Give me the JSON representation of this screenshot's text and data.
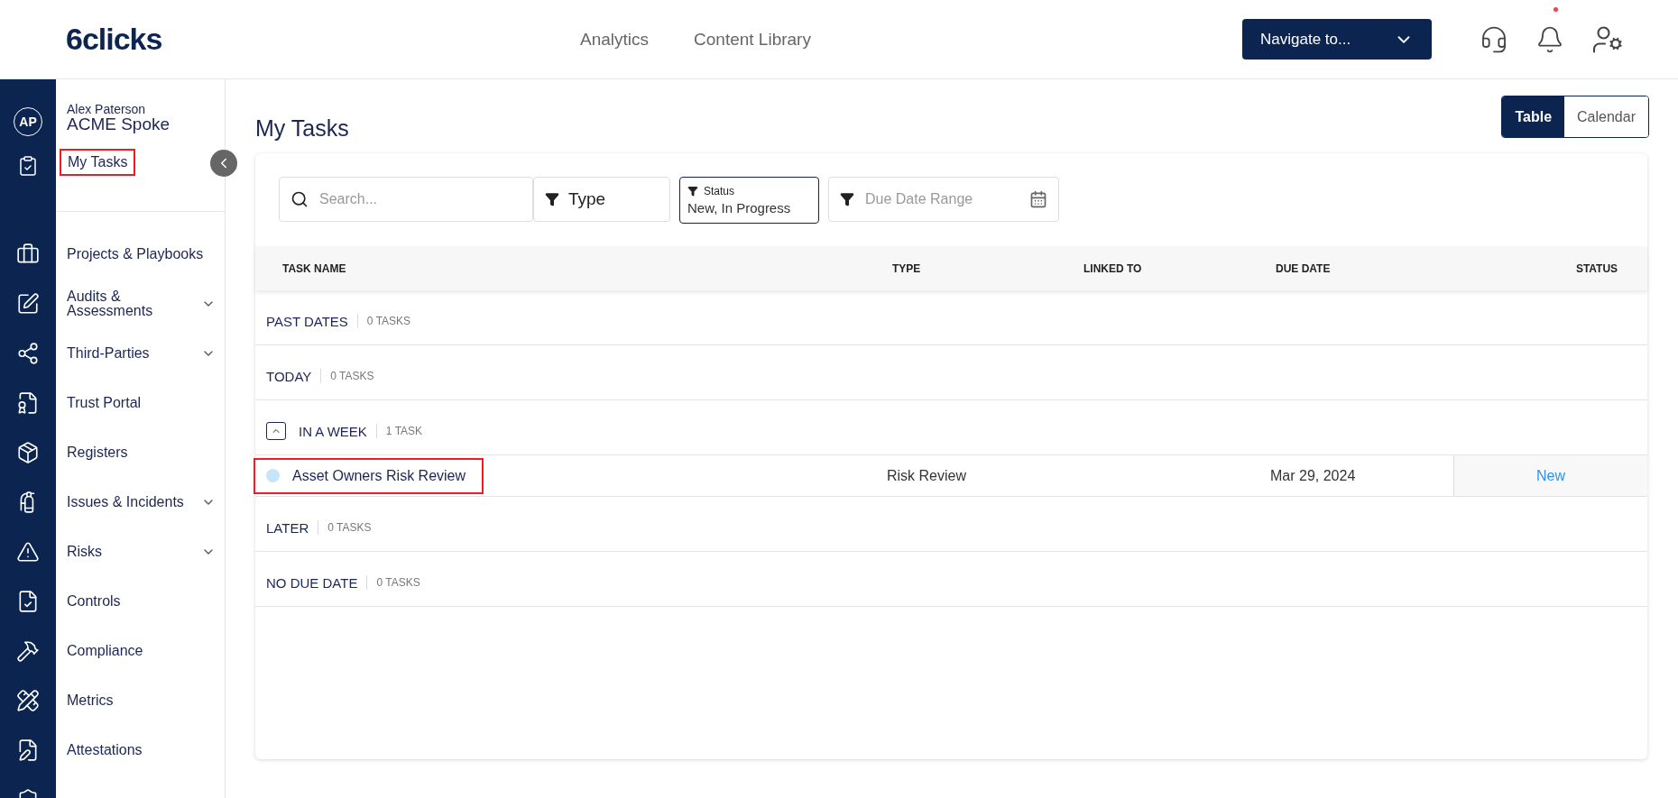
{
  "header": {
    "logo": "6clicks",
    "nav": [
      {
        "label": "Analytics"
      },
      {
        "label": "Content Library"
      }
    ],
    "navigate": {
      "label": "Navigate to..."
    },
    "bell_unread": true
  },
  "rail": {
    "avatar": "AP"
  },
  "sidebar": {
    "user_name": "Alex Paterson",
    "org": "ACME Spoke",
    "current": {
      "label": "My Tasks",
      "highlighted": true
    },
    "items": [
      {
        "label": "Projects & Playbooks",
        "expandable": false
      },
      {
        "label": "Audits & Assessments",
        "expandable": true
      },
      {
        "label": "Third-Parties",
        "expandable": true
      },
      {
        "label": "Trust Portal",
        "expandable": false
      },
      {
        "label": "Registers",
        "expandable": false
      },
      {
        "label": "Issues & Incidents",
        "expandable": true
      },
      {
        "label": "Risks",
        "expandable": true
      },
      {
        "label": "Controls",
        "expandable": false
      },
      {
        "label": "Compliance",
        "expandable": false
      },
      {
        "label": "Metrics",
        "expandable": false
      },
      {
        "label": "Attestations",
        "expandable": false
      }
    ]
  },
  "page": {
    "title": "My Tasks",
    "view_toggle": [
      {
        "label": "Table",
        "selected": true
      },
      {
        "label": "Calendar",
        "selected": false
      }
    ]
  },
  "filters": {
    "search": {
      "placeholder": "Search..."
    },
    "type": {
      "label": "Type"
    },
    "status": {
      "label": "Status",
      "value": "New, In Progress"
    },
    "due_date": {
      "placeholder": "Due Date Range"
    }
  },
  "table": {
    "columns": [
      "TASK NAME",
      "TYPE",
      "LINKED TO",
      "DUE DATE",
      "STATUS"
    ],
    "groups": [
      {
        "label": "PAST DATES",
        "count": "0 TASKS"
      },
      {
        "label": "TODAY",
        "count": "0 TASKS"
      },
      {
        "label": "IN A WEEK",
        "count": "1 TASK",
        "expanded": true,
        "tasks": [
          {
            "name": "Asset Owners Risk Review",
            "color": "#c6e4fb",
            "type": "Risk Review",
            "due_date": "Mar 29, 2024",
            "status": "New",
            "highlighted": true
          }
        ]
      },
      {
        "label": "LATER",
        "count": "0 TASKS"
      },
      {
        "label": "NO DUE DATE",
        "count": "0 TASKS"
      }
    ]
  }
}
